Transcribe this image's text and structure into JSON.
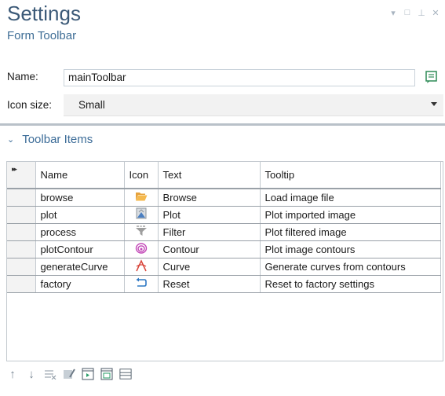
{
  "header": {
    "title": "Settings",
    "subtitle": "Form Toolbar"
  },
  "window_controls": [
    "pin-dropdown-icon",
    "restore-icon",
    "pin-icon",
    "close-icon"
  ],
  "form": {
    "name_label": "Name:",
    "name_value": "mainToolbar",
    "icon_size_label": "Icon size:",
    "icon_size_value": "Small"
  },
  "section": {
    "label": "Toolbar Items"
  },
  "table": {
    "row_header_marker": "▸▸",
    "columns": [
      "Name",
      "Icon",
      "Text",
      "Tooltip"
    ],
    "rows": [
      {
        "name": "browse",
        "icon": "folder-open-icon",
        "text": "Browse",
        "tooltip": "Load image file"
      },
      {
        "name": "plot",
        "icon": "plot-image-icon",
        "text": "Plot",
        "tooltip": "Plot imported image"
      },
      {
        "name": "process",
        "icon": "filter-icon",
        "text": "Filter",
        "tooltip": "Plot filtered image"
      },
      {
        "name": "plotContour",
        "icon": "contour-icon",
        "text": "Contour",
        "tooltip": "Plot image contours"
      },
      {
        "name": "generateCurve",
        "icon": "curve-icon",
        "text": "Curve",
        "tooltip": "Generate curves from contours"
      },
      {
        "name": "factory",
        "icon": "reset-arrow-icon",
        "text": "Reset",
        "tooltip": "Reset to factory settings"
      }
    ]
  },
  "bottom_toolbar": [
    "move-up-icon",
    "move-down-icon",
    "delete-rows-icon",
    "clear-icon",
    "add-row-icon",
    "edit-row-icon",
    "layout-icon"
  ],
  "colors": {
    "title": "#3c5a78",
    "accent": "#3c6c98"
  }
}
